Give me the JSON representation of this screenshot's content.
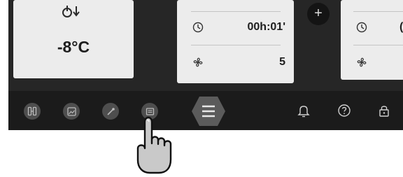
{
  "left_card": {
    "icon": "thermometer-down-icon",
    "temperature": "-8°C"
  },
  "middle_card": {
    "timer_icon": "clock-icon",
    "timer_value": "00h:01'",
    "fan_icon": "fan-icon",
    "fan_value": "5"
  },
  "right_card": {
    "timer_icon": "clock-icon",
    "timer_value_partial": "(",
    "fan_icon": "fan-icon"
  },
  "add_button": {
    "label": "+"
  },
  "bottom_bar": {
    "left_buttons": [
      "mode-icon",
      "picture-icon",
      "probe-icon",
      "document-icon"
    ],
    "center_button": "menu-icon",
    "right_icons": [
      "bell-icon",
      "help-icon",
      "lock-icon"
    ]
  },
  "overlay": {
    "pointer": "hand-pointer-icon"
  }
}
